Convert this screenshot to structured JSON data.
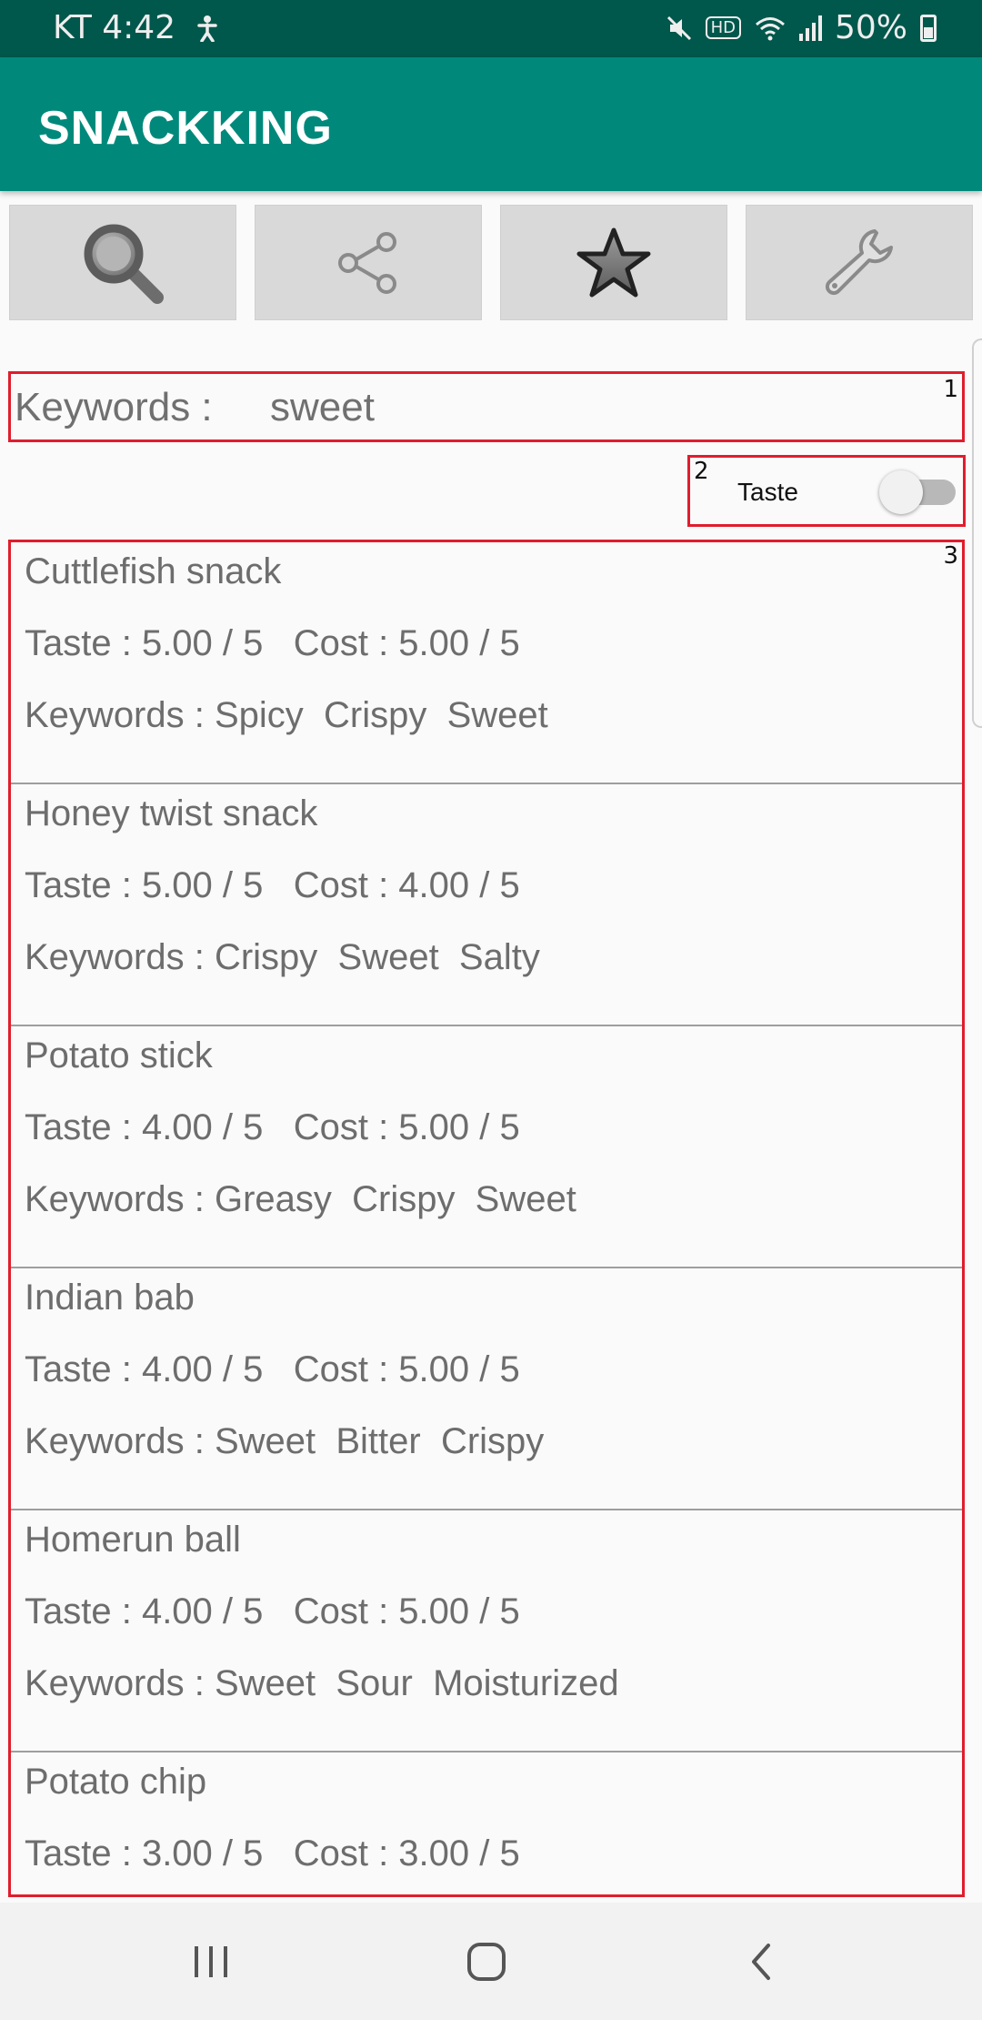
{
  "status_bar": {
    "carrier_time": "KT 4:42",
    "battery": "50%",
    "hd": "HD"
  },
  "app_bar": {
    "title": "SNACKKING"
  },
  "toolbar": {
    "icons": [
      "search-icon",
      "share-icon",
      "star-icon",
      "wrench-icon"
    ]
  },
  "search": {
    "keywords_label": "Keywords :",
    "keywords_value": "sweet",
    "box_number": "1"
  },
  "sort": {
    "label": "Taste",
    "toggle_on": false,
    "box_number": "2"
  },
  "list": {
    "box_number": "3",
    "items": [
      {
        "name": "Cuttlefish snack",
        "ratings": "Taste : 5.00 / 5   Cost : 5.00 / 5",
        "keywords": "Keywords : Spicy  Crispy  Sweet"
      },
      {
        "name": "Honey twist snack",
        "ratings": "Taste : 5.00 / 5   Cost : 4.00 / 5",
        "keywords": "Keywords : Crispy  Sweet  Salty"
      },
      {
        "name": "Potato stick",
        "ratings": "Taste : 4.00 / 5   Cost : 5.00 / 5",
        "keywords": "Keywords : Greasy  Crispy  Sweet"
      },
      {
        "name": "Indian bab",
        "ratings": "Taste : 4.00 / 5   Cost : 5.00 / 5",
        "keywords": "Keywords : Sweet  Bitter  Crispy"
      },
      {
        "name": "Homerun ball",
        "ratings": "Taste : 4.00 / 5   Cost : 5.00 / 5",
        "keywords": "Keywords : Sweet  Sour  Moisturized"
      },
      {
        "name": "Potato chip",
        "ratings": "Taste : 3.00 / 5   Cost : 3.00 / 5",
        "keywords": ""
      }
    ]
  }
}
